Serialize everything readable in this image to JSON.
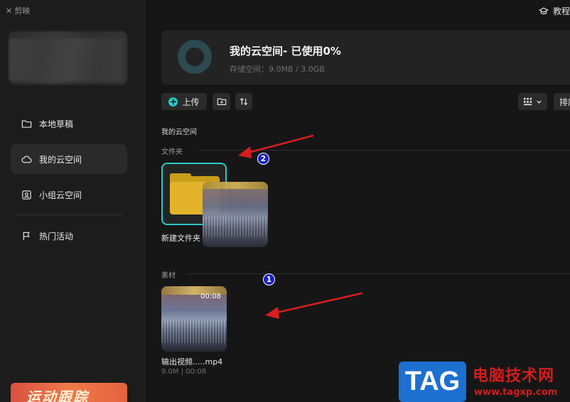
{
  "app": {
    "name": "剪映"
  },
  "header": {
    "tutorial_label": "教程"
  },
  "sidebar": {
    "items": [
      {
        "label": "本地草稿",
        "icon": "folder-icon",
        "active": false
      },
      {
        "label": "我的云空间",
        "icon": "cloud-icon",
        "active": true
      },
      {
        "label": "小组云空间",
        "icon": "team-cloud-icon",
        "active": false
      },
      {
        "label": "热门活动",
        "icon": "flag-icon",
        "active": false
      }
    ],
    "promo_label": "运动跟踪"
  },
  "storage": {
    "title": "我的云空间- 已使用0%",
    "subtitle": "存储空间：9.0MB / 3.0GB",
    "used_percent": 0
  },
  "toolbar": {
    "upload_label": "上传",
    "sort_label": "排序"
  },
  "breadcrumb": "我的云空间",
  "sections": {
    "folders_label": "文件夹",
    "materials_label": "素材"
  },
  "folder": {
    "name": "新建文件夹"
  },
  "video": {
    "duration": "00:08",
    "name": "输出视频.....mp4",
    "meta": "9.0M | 00:08"
  },
  "annotations": {
    "badge1": "1",
    "badge2": "2",
    "arrow_color": "#d81e1e",
    "badge_color": "#1a1fbf"
  },
  "watermark": {
    "tag": "TAG",
    "text": "电脑技术网",
    "url": "www.tagxp.com"
  },
  "colors": {
    "accent": "#2ec6c6",
    "folder": "#e2b32a",
    "background": "#161616",
    "sidebar": "#1c1c1c"
  }
}
